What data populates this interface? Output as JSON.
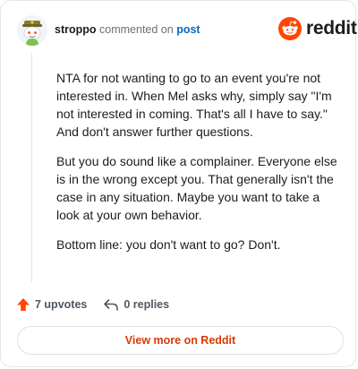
{
  "header": {
    "username": "stroppo",
    "action_text": "commented on",
    "post_link": "post",
    "logo_text": "reddit"
  },
  "comment": {
    "paragraphs": [
      "NTA for not wanting to go to an event you're not interested in. When Mel asks why, simply say \"I'm not interested in coming. That's all I have to say.\" And don't answer further questions.",
      "But you do sound like a complainer. Everyone else is in the wrong except you. That generally isn't the case in any situation. Maybe you want to take a look at your own behavior.",
      "Bottom line: you don't want to go? Don't."
    ]
  },
  "actions": {
    "upvotes_label": "7 upvotes",
    "replies_label": "0 replies"
  },
  "footer": {
    "view_more_label": "View more on Reddit"
  },
  "colors": {
    "brand": "#ff4500",
    "link": "#0a66c2",
    "view_more_text": "#d93a00"
  },
  "icons": {
    "avatar": "snoo-avatar-icon",
    "logo": "reddit-logo-icon",
    "upvote": "upvote-arrow-icon",
    "reply": "reply-arrow-icon"
  }
}
